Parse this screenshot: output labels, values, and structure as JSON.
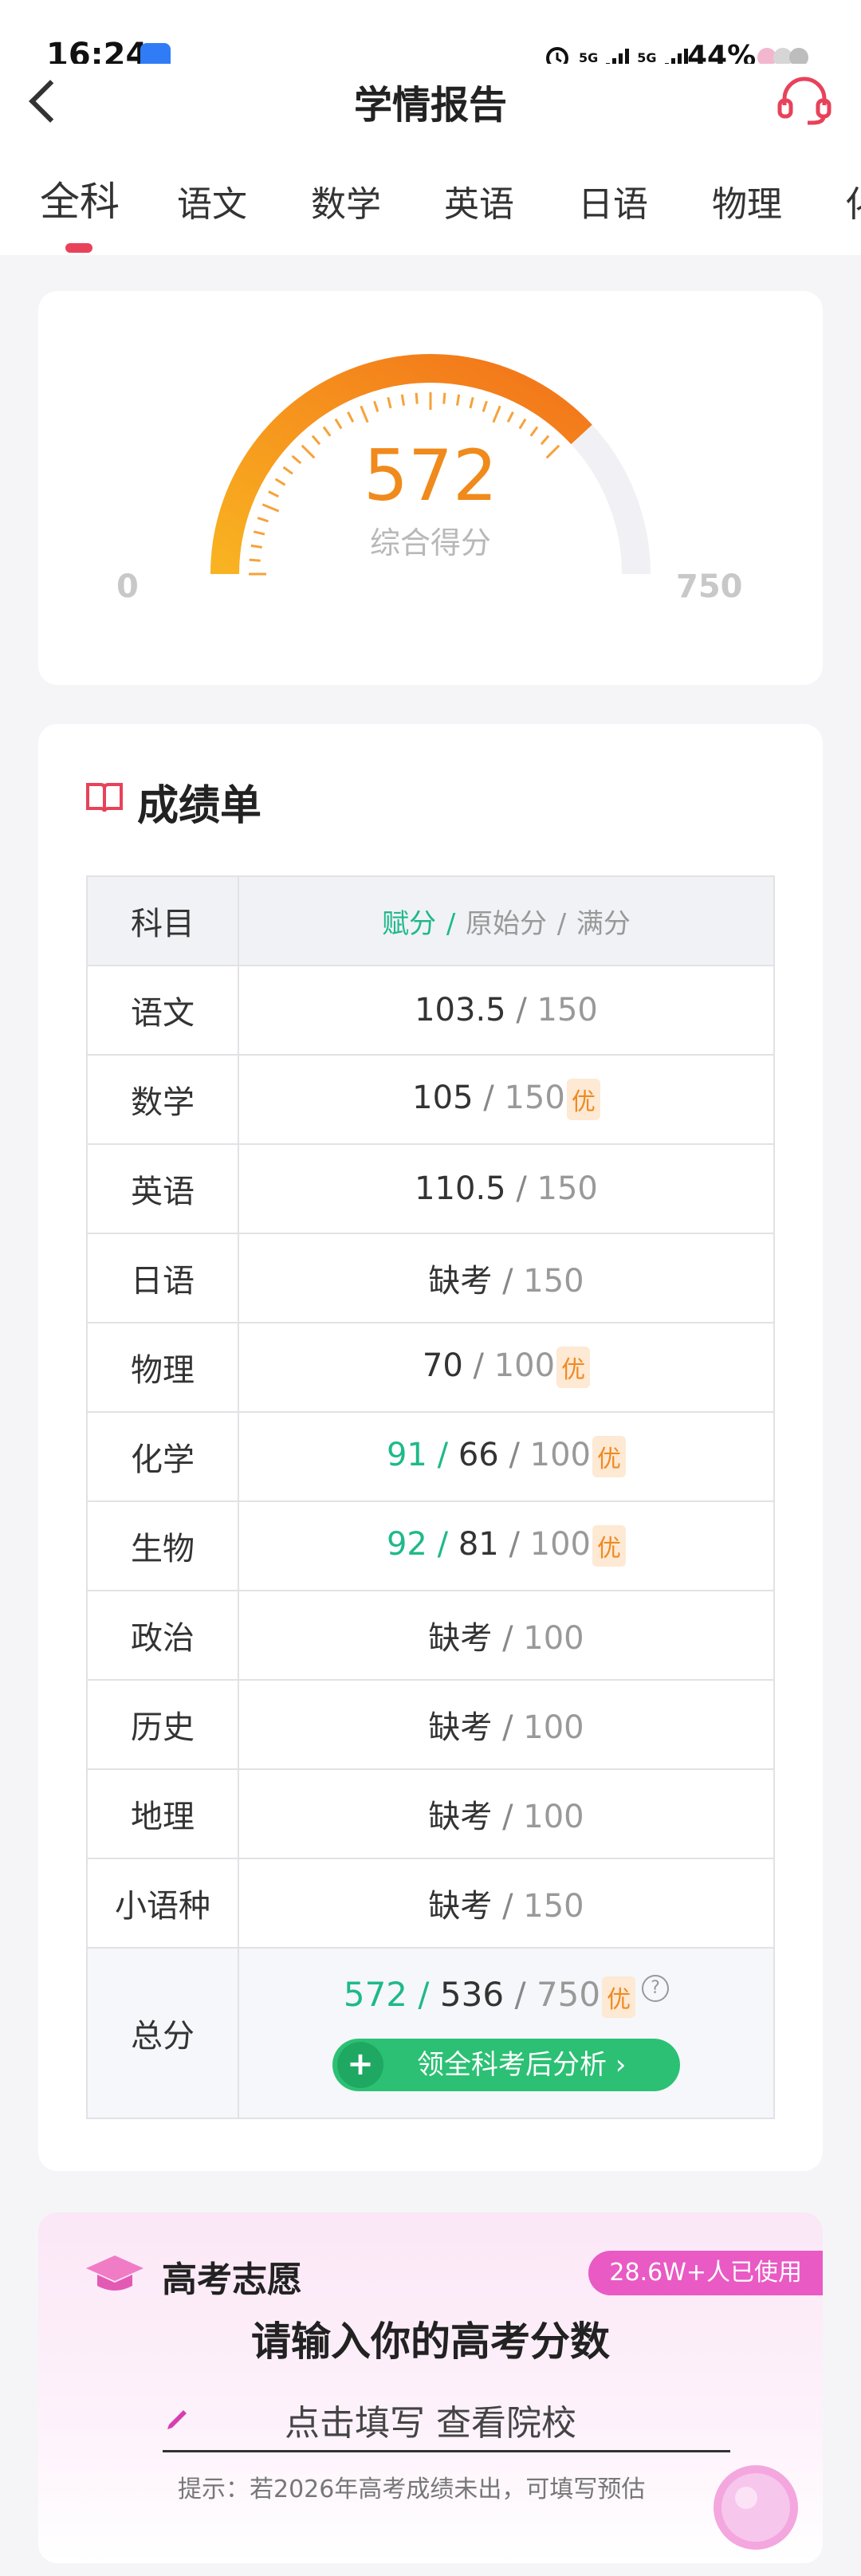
{
  "status_bar": {
    "time": "16:24",
    "battery": "44%",
    "net1": "5G",
    "net2": "5G"
  },
  "header": {
    "title": "学情报告"
  },
  "tabs": [
    {
      "label": "全科",
      "active": true
    },
    {
      "label": "语文"
    },
    {
      "label": "数学"
    },
    {
      "label": "英语"
    },
    {
      "label": "日语"
    },
    {
      "label": "物理"
    },
    {
      "label": "化"
    }
  ],
  "gauge": {
    "score": "572",
    "label": "综合得分",
    "min": "0",
    "max": "750",
    "score_value": 572,
    "max_value": 750
  },
  "grade_sheet": {
    "title": "成绩单",
    "header": {
      "subject": "科目",
      "assigned": "赋分",
      "raw": "原始分",
      "full": "满分",
      "sep": "/"
    },
    "rows": [
      {
        "subject": "语文",
        "assigned": "",
        "raw": "103.5",
        "full": "150",
        "tag": ""
      },
      {
        "subject": "数学",
        "assigned": "",
        "raw": "105",
        "full": "150",
        "tag": "优"
      },
      {
        "subject": "英语",
        "assigned": "",
        "raw": "110.5",
        "full": "150",
        "tag": ""
      },
      {
        "subject": "日语",
        "assigned": "",
        "raw": "缺考",
        "full": "150",
        "tag": ""
      },
      {
        "subject": "物理",
        "assigned": "",
        "raw": "70",
        "full": "100",
        "tag": "优"
      },
      {
        "subject": "化学",
        "assigned": "91",
        "raw": "66",
        "full": "100",
        "tag": "优"
      },
      {
        "subject": "生物",
        "assigned": "92",
        "raw": "81",
        "full": "100",
        "tag": "优"
      },
      {
        "subject": "政治",
        "assigned": "",
        "raw": "缺考",
        "full": "100",
        "tag": ""
      },
      {
        "subject": "历史",
        "assigned": "",
        "raw": "缺考",
        "full": "100",
        "tag": ""
      },
      {
        "subject": "地理",
        "assigned": "",
        "raw": "缺考",
        "full": "100",
        "tag": ""
      },
      {
        "subject": "小语种",
        "assigned": "",
        "raw": "缺考",
        "full": "150",
        "tag": ""
      }
    ],
    "total": {
      "subject": "总分",
      "assigned": "572",
      "raw": "536",
      "full": "750",
      "tag": "优",
      "help": "?",
      "button_plus": "+",
      "button": "领全科考后分析 ›"
    }
  },
  "gaokao": {
    "title": "高考志愿",
    "badge": "28.6W+人已使用",
    "main": "请输入你的高考分数",
    "input": "点击填写 查看院校",
    "hint": "提示：若2026年高考成绩未出，可填写预估"
  },
  "colors": {
    "accent_red": "#e8425a",
    "gauge_orange": "#f08a1c",
    "green": "#1fb98a",
    "button_green": "#2cc074",
    "badge_pink": "#e95ac4"
  }
}
